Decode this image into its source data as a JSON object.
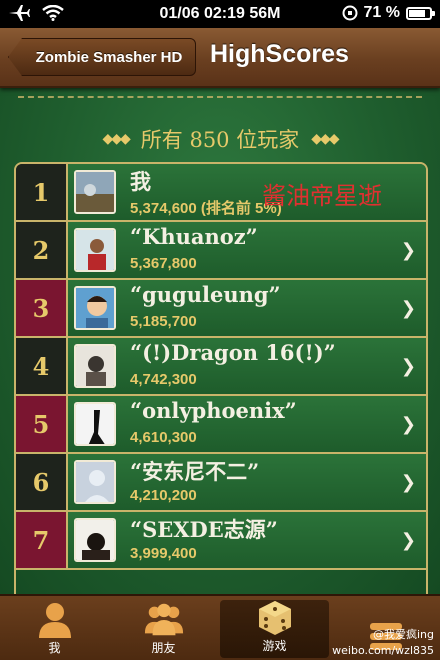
{
  "status": {
    "time": "01/06 02:19 56M",
    "battery": "71 %",
    "battery_level": 0.71
  },
  "nav": {
    "back_label": "Zombie Smasher HD",
    "title": "HighScores"
  },
  "header": {
    "players_text": "所有 850 位玩家"
  },
  "rows": [
    {
      "rank": "1",
      "name": "我",
      "score": "5,374,600 (排名前 5%)"
    },
    {
      "rank": "2",
      "name": "“Khuanoz”",
      "score": "5,367,800"
    },
    {
      "rank": "3",
      "name": "“guguleung”",
      "score": "5,185,700"
    },
    {
      "rank": "4",
      "name": "“(!)Dragon 16(!)”",
      "score": "4,742,300"
    },
    {
      "rank": "5",
      "name": "“onlyphoenix”",
      "score": "4,610,300"
    },
    {
      "rank": "6",
      "name": "“安东尼不二”",
      "score": "4,210,200"
    },
    {
      "rank": "7",
      "name": "“SEXDE志源”",
      "score": "3,999,400"
    }
  ],
  "overlay_text": "酱油帝星逝",
  "tabs": [
    {
      "label": "我",
      "icon": "person-icon"
    },
    {
      "label": "朋友",
      "icon": "friends-icon"
    },
    {
      "label": "游戏",
      "icon": "dice-icon"
    },
    {
      "label": "",
      "icon": "stack-icon"
    }
  ],
  "weibo": {
    "handle": "@我爱疯ing",
    "url": "weibo.com/wzl835"
  }
}
